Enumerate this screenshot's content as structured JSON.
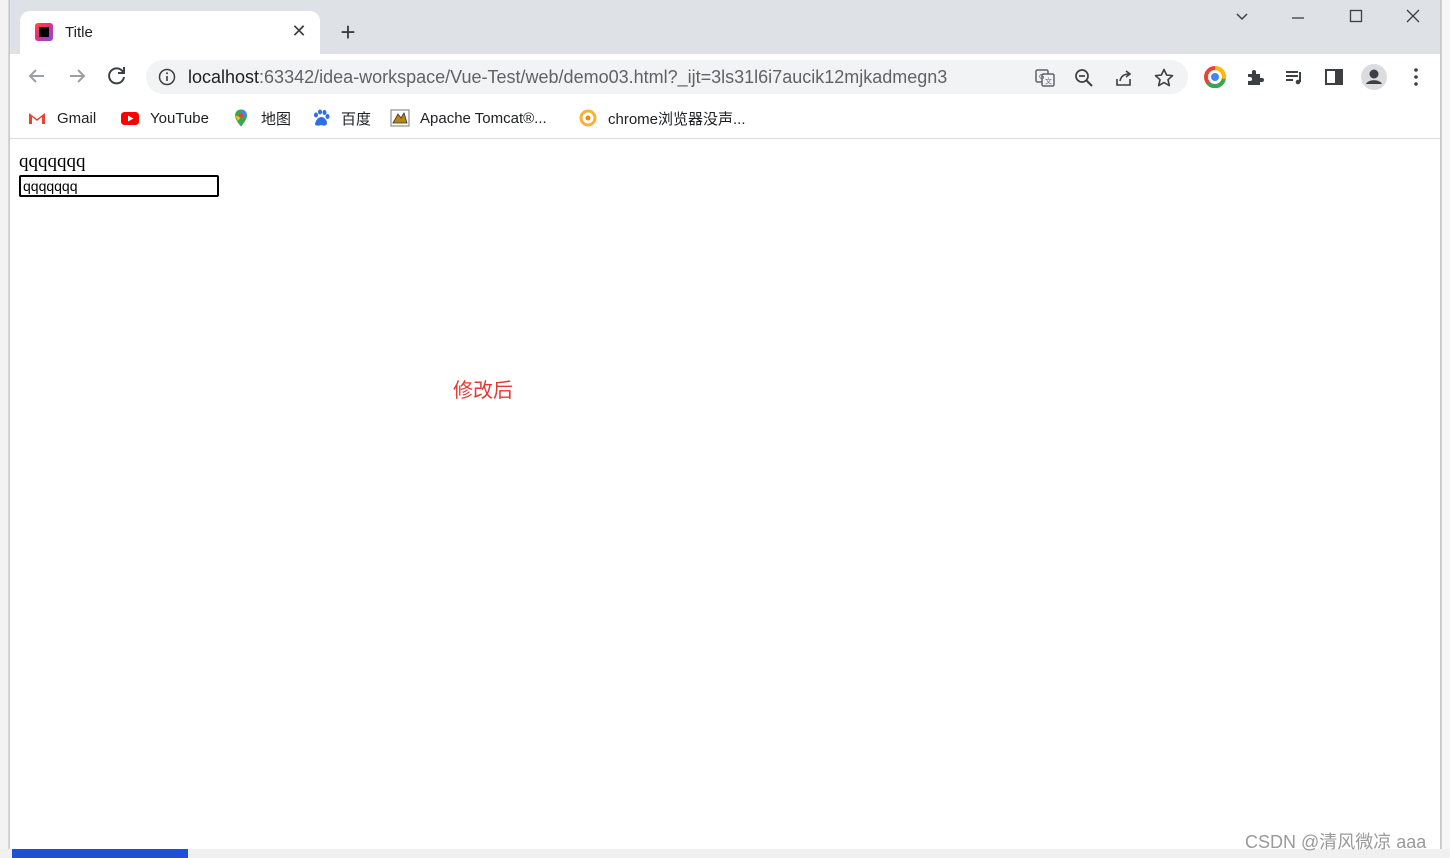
{
  "browser": {
    "tab": {
      "title": "Title",
      "close": "✕"
    },
    "new_tab": "+",
    "address": {
      "host": "localhost",
      "path": ":63342/idea-workspace/Vue-Test/web/demo03.html?_ijt=3ls31l6i7aucik12mjkadmegn3"
    },
    "bookmarks": [
      {
        "label": "Gmail",
        "icon": "gmail-icon"
      },
      {
        "label": "YouTube",
        "icon": "youtube-icon"
      },
      {
        "label": "地图",
        "icon": "maps-icon"
      },
      {
        "label": "百度",
        "icon": "baidu-icon"
      },
      {
        "label": "Apache Tomcat®...",
        "icon": "tomcat-icon"
      },
      {
        "label": "chrome浏览器没声...",
        "icon": "chrome-help-icon"
      }
    ]
  },
  "page": {
    "message_text": "qqqqqqq",
    "input_value": "qqqqqqq",
    "modified_text": "修改后"
  },
  "watermark": "CSDN @清风微凉 aaa",
  "colors": {
    "tabstrip": "#dee1e6",
    "accent_red": "#e53935"
  }
}
